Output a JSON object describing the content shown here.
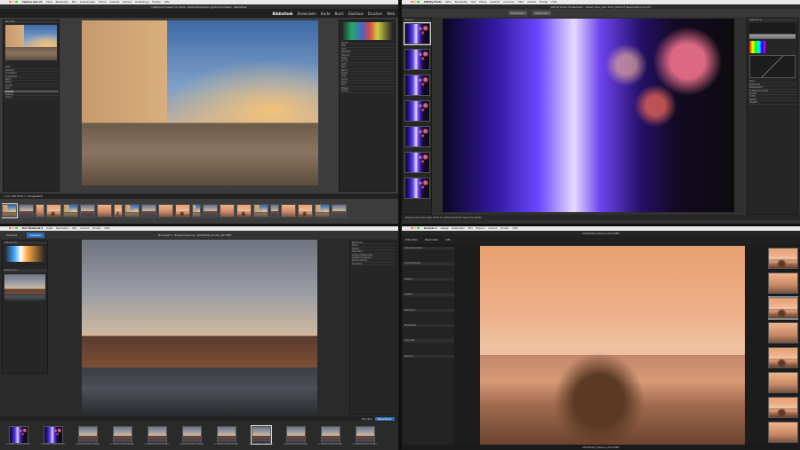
{
  "q1": {
    "app": "Capture One 21",
    "menu": [
      "Capture One",
      "Datei",
      "Bearbeiten",
      "Bild",
      "Anpassungen",
      "Ebene",
      "Auswahl",
      "Kamera",
      "Darstellung",
      "Fenster",
      "Hilfe"
    ],
    "title": "Lightroom Classic CC 2019 - Adobe Photoshop Lightroom Classic - Bibliothek",
    "modules": [
      "Bibliothek",
      "Entwickeln",
      "Karte",
      "Buch",
      "Diashow",
      "Drucken",
      "Web"
    ],
    "panel_header": "Navigator",
    "folders": [
      "2019",
      "2019-03",
      "Architektur",
      "Aufnahmen",
      "Berlin",
      "Italien",
      "London",
      "Rom",
      "Venedig",
      "Toskana",
      "Export"
    ],
    "keywords": [
      "Abend",
      "Blau",
      "Dom",
      "Gebäude",
      "Himmel",
      "Italien",
      "Kirche",
      "Licht",
      "Meer",
      "Nacht",
      "Palast",
      "Platz",
      "Sonne",
      "Stadt",
      "Turm",
      "Wasser",
      "Wolken"
    ],
    "status": "1 von 240 Fotos / 1 ausgewählt",
    "thumb_count": 22
  },
  "q2": {
    "app": "Affinity Photo",
    "menu": [
      "Affinity Photo",
      "Datei",
      "Bearbeiten",
      "Text",
      "Ebene",
      "Auswahl",
      "Anordnen",
      "Filter",
      "Ansicht",
      "Fenster",
      "Hilfe"
    ],
    "title": "Affinity Photo (Entwickeln) - Bokeh_Blau_ASC 2019_0244.tif [Bearbeitet] (42,0%)",
    "panel_header": "Stempel",
    "tabs": [
      "Entwickeln",
      "Abbrechen"
    ],
    "histogram_label": "Histogramm",
    "right_sections": [
      "Basis",
      "Belichtung",
      "Weißabgleich",
      "Schatten & Lichter",
      "Kurven",
      "Profile",
      "Details",
      "Objektiv"
    ],
    "status": "Drag to pan the view. Click on a thumbnail to open the photo.",
    "thumb_count": 7
  },
  "q3": {
    "app": "DxO PhotoLab 3",
    "menu": [
      "DxO PhotoLab",
      "Datei",
      "Bearbeiten",
      "Bild",
      "Ansicht",
      "Fenster",
      "Hilfe"
    ],
    "tabs": [
      "Fotothek",
      "Anpassen"
    ],
    "title": "PhotoLab 3 - Bildbearbeitung - 20190406_London_007.NEF",
    "panel_header": "Histogramm",
    "left_label": "Bildvorschau",
    "right_sections": [
      "Belichtung",
      "Farbe",
      "Details",
      "Geometrie",
      "Lokale Anpassungen",
      "Selektive Tonwerte",
      "Smart Lighting",
      "ClearView"
    ],
    "filmstrip_count": 11,
    "filmstrip_names": [
      "20190406_London_001.NEF",
      "20190406_London_002.NEF",
      "20190406_London_003.NEF",
      "20190406_London_004.NEF",
      "20190406_London_005.NEF",
      "20190406_London_006.NEF",
      "20190406_London_007.NEF",
      "20190406_London_008.NEF",
      "20190406_London_009.NEF",
      "20190406_London_010.NEF",
      "20190406_London_011.NEF"
    ],
    "footer": [
      "Drucken",
      "Exportieren"
    ]
  },
  "q4": {
    "app": "Luminar 4",
    "menu": [
      "Luminar 4",
      "Ablage",
      "Bearbeiten",
      "Bild",
      "Ebenen",
      "Ansicht",
      "Fenster",
      "Hilfe"
    ],
    "title": "20190506_Toskana_0123.NEF",
    "tools": [
      "Bibliothek",
      "Bearbeiten",
      "Info"
    ],
    "info_sections": [
      "Datei-Information",
      "Aufnahmedaten",
      "Kamera",
      "Objektiv",
      "Belichtung",
      "Stichwörter",
      "Copyright",
      "Standort"
    ],
    "status": "20190506_Toskana_0123.NEF",
    "thumb_count": 8
  }
}
